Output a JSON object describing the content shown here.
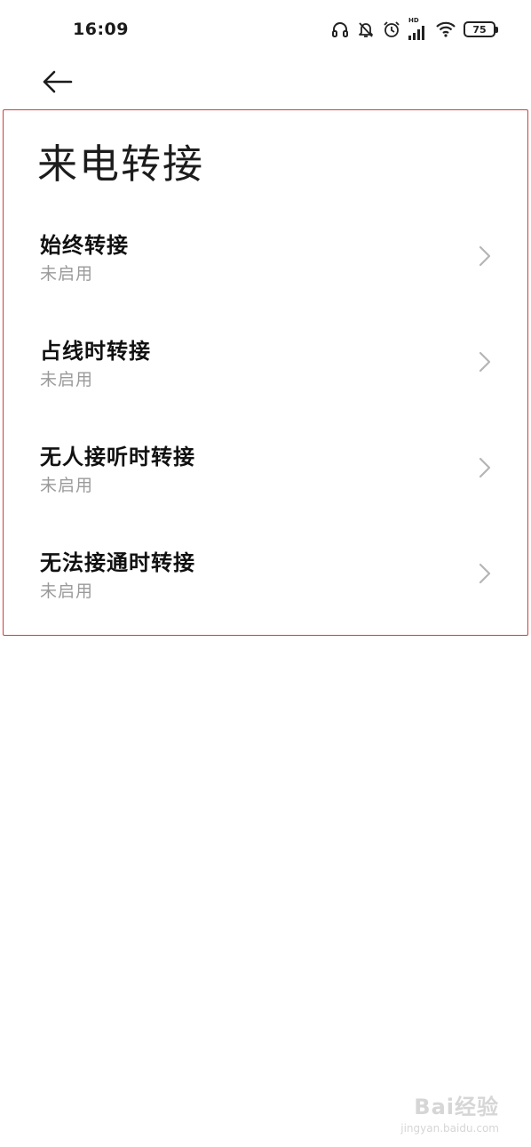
{
  "status_bar": {
    "time": "16:09",
    "network_label": "HD",
    "battery": "75",
    "icons": [
      "headphones-icon",
      "silent-bell-icon",
      "alarm-icon",
      "signal-icon",
      "wifi-icon",
      "battery-icon"
    ]
  },
  "nav": {
    "back_icon": "arrow-left-icon"
  },
  "page": {
    "title": "来电转接"
  },
  "items": [
    {
      "title": "始终转接",
      "status": "未启用"
    },
    {
      "title": "占线时转接",
      "status": "未启用"
    },
    {
      "title": "无人接听时转接",
      "status": "未启用"
    },
    {
      "title": "无法接通时转接",
      "status": "未启用"
    }
  ],
  "colors": {
    "highlight_border": "#d43c3c",
    "secondary_text": "#9a9a9a",
    "chevron": "#b5b5b5"
  },
  "watermark": {
    "logo": "Bai经验",
    "url": "jingyan.baidu.com"
  }
}
